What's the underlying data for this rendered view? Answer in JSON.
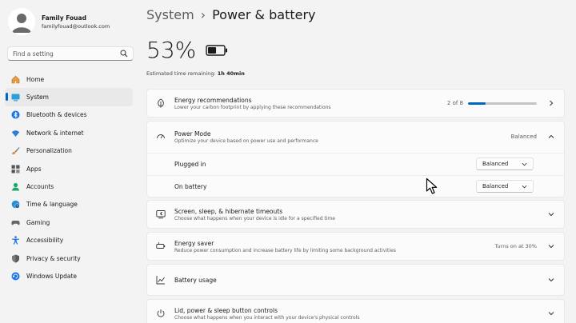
{
  "profile": {
    "name": "Family Fouad",
    "email": "familyfouad@outlook.com"
  },
  "search": {
    "placeholder": "Find a setting"
  },
  "nav": {
    "items": [
      {
        "label": "Home",
        "icon": "home-icon"
      },
      {
        "label": "System",
        "icon": "system-icon",
        "selected": true
      },
      {
        "label": "Bluetooth & devices",
        "icon": "bluetooth-icon"
      },
      {
        "label": "Network & internet",
        "icon": "wifi-icon"
      },
      {
        "label": "Personalization",
        "icon": "brush-icon"
      },
      {
        "label": "Apps",
        "icon": "apps-icon"
      },
      {
        "label": "Accounts",
        "icon": "accounts-icon"
      },
      {
        "label": "Time & language",
        "icon": "globe-clock-icon"
      },
      {
        "label": "Gaming",
        "icon": "gamepad-icon"
      },
      {
        "label": "Accessibility",
        "icon": "accessibility-icon"
      },
      {
        "label": "Privacy & security",
        "icon": "shield-icon"
      },
      {
        "label": "Windows Update",
        "icon": "update-icon"
      }
    ]
  },
  "header": {
    "parent": "System",
    "separator": "›",
    "current": "Power & battery"
  },
  "battery": {
    "percent_label": "53%",
    "level": 0.53,
    "estimate_label": "Estimated time remaining:",
    "estimate_value": "1h 40min"
  },
  "energy_recs": {
    "title": "Energy recommendations",
    "subtitle": "Lower your carbon footprint by applying these recommendations",
    "progress_text": "2 of 8",
    "progress": 0.25
  },
  "power_mode": {
    "title": "Power Mode",
    "subtitle": "Optimize your device based on power use and performance",
    "value": "Balanced",
    "plugged_in_label": "Plugged in",
    "plugged_in_value": "Balanced",
    "on_battery_label": "On battery",
    "on_battery_value": "Balanced"
  },
  "screen_sleep": {
    "title": "Screen, sleep, & hibernate timeouts",
    "subtitle": "Choose what happens when your device is idle for a specified time"
  },
  "energy_saver": {
    "title": "Energy saver",
    "subtitle": "Reduce power consumption and increase battery life by limiting some background activities",
    "value": "Turns on at 30%"
  },
  "battery_usage": {
    "title": "Battery usage"
  },
  "lid_power": {
    "title": "Lid, power & sleep button controls",
    "subtitle": "Choose what happens when you interact with your device's physical controls"
  },
  "colors": {
    "accent": "#0067c0",
    "background": "#f3f3f3",
    "card": "#fbfbfb"
  }
}
